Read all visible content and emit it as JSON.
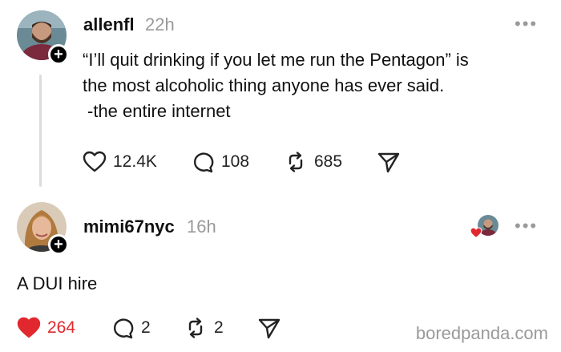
{
  "post": {
    "username": "allenfl",
    "time": "22h",
    "more_label": "•••",
    "lines": [
      "“I’ll quit drinking if you let me run the Pentagon” is",
      "the most alcoholic thing anyone has ever said.",
      "-the entire internet"
    ],
    "likes": "12.4K",
    "comments": "108",
    "reposts": "685"
  },
  "reply": {
    "username": "mimi67nyc",
    "time": "16h",
    "more_label": "•••",
    "text": "A DUI hire",
    "likes": "264",
    "comments": "2",
    "reposts": "2"
  },
  "watermark": "boredpanda.com",
  "colors": {
    "like_active": "#e0282e",
    "muted": "#9a9a9a"
  },
  "icons": [
    "heart-icon",
    "comment-icon",
    "repost-icon",
    "share-icon",
    "plus-icon"
  ]
}
